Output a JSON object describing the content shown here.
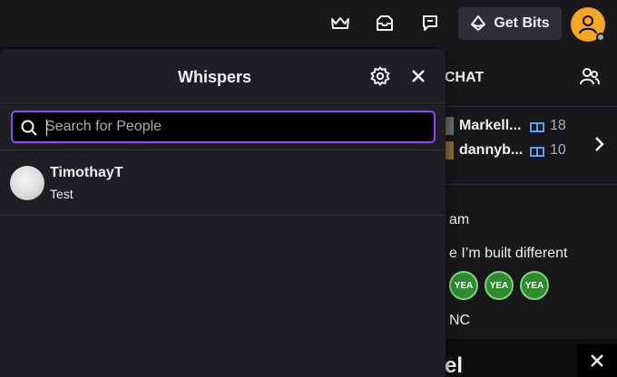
{
  "topnav": {
    "icons": [
      "crown-icon",
      "inbox-icon",
      "whisper-icon"
    ],
    "get_bits_label": "Get Bits"
  },
  "chat": {
    "title": "CHAT",
    "gifters": [
      {
        "name": "Markell...",
        "count": "18"
      },
      {
        "name": "dannyb...",
        "count": "10"
      }
    ],
    "lines": [
      "am",
      "e I’m built different",
      "NC"
    ],
    "emotes": [
      "YEA",
      "YEA",
      "YEA"
    ],
    "bottom_text": "el"
  },
  "whispers": {
    "title": "Whispers",
    "search": {
      "placeholder": "Search for People",
      "value": ""
    },
    "threads": [
      {
        "name": "TimothayT",
        "preview": "Test"
      }
    ]
  },
  "colors": {
    "accent": "#9147ff",
    "avatar": "#f5a623",
    "gift": "#5c9cff",
    "emote": "#2e8b2e"
  }
}
